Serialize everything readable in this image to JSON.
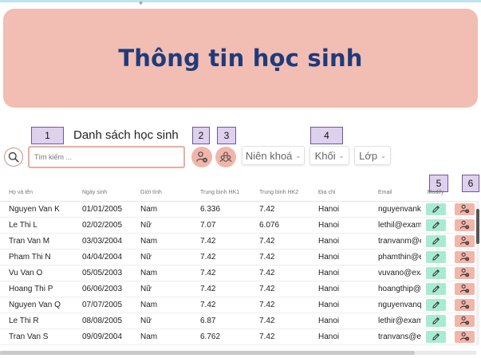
{
  "header": {
    "title": "Thông tin học sinh"
  },
  "toolbar": {
    "section_title": "Danh sách học sinh",
    "search_placeholder": "Tìm kiếm ...",
    "filters": {
      "nien_khoa": "Niên khoá",
      "khoi": "Khối",
      "lop": "Lớp"
    }
  },
  "annotations": {
    "n1": "1",
    "n2": "2",
    "n3": "3",
    "n4": "4",
    "n5": "5",
    "n6": "6"
  },
  "table": {
    "columns": [
      "Họ và tên",
      "Ngày sinh",
      "Giới tính",
      "Trung bình HK1",
      "Trung bình HK2",
      "Địa chỉ",
      "Email",
      "Modify"
    ],
    "rows": [
      [
        "Nguyen Van K",
        "01/01/2005",
        "Nam",
        "6.336",
        "7.42",
        "Hanoi",
        "nguyenvank@e"
      ],
      [
        "Le Thi L",
        "02/02/2005",
        "Nữ",
        "7.07",
        "6.076",
        "Hanoi",
        "lethil@example"
      ],
      [
        "Tran Van M",
        "03/03/2004",
        "Nam",
        "7.42",
        "7.42",
        "Hanoi",
        "tranvanm@exa"
      ],
      [
        "Pham Thi N",
        "04/04/2004",
        "Nữ",
        "7.42",
        "7.42",
        "Hanoi",
        "phamthin@exa"
      ],
      [
        "Vu Van O",
        "05/05/2003",
        "Nam",
        "7.42",
        "7.42",
        "Hanoi",
        "vuvano@examp"
      ],
      [
        "Hoang Thi P",
        "06/06/2003",
        "Nữ",
        "7.42",
        "7.42",
        "Hanoi",
        "hoangthip@exa"
      ],
      [
        "Nguyen Van Q",
        "07/07/2005",
        "Nam",
        "7.42",
        "7.42",
        "Hanoi",
        "nguyenvanq@e"
      ],
      [
        "Le Thi R",
        "08/08/2005",
        "Nữ",
        "6.87",
        "7.42",
        "Hanoi",
        "lethir@example"
      ],
      [
        "Tran Van S",
        "09/09/2004",
        "Nam",
        "6.762",
        "7.42",
        "Hanoi",
        "tranvans@exam"
      ]
    ]
  },
  "colors": {
    "banner": "#f2bdb3",
    "title": "#1f3b7a",
    "edit_button": "#a8ebd2",
    "delete_button": "#f2b5aa",
    "annotation_badge": "#ddd1ee"
  },
  "icons": {
    "search": "search-icon",
    "add_student": "add-user-icon",
    "group": "users-icon",
    "edit": "pencil-icon",
    "delete": "remove-user-icon"
  }
}
